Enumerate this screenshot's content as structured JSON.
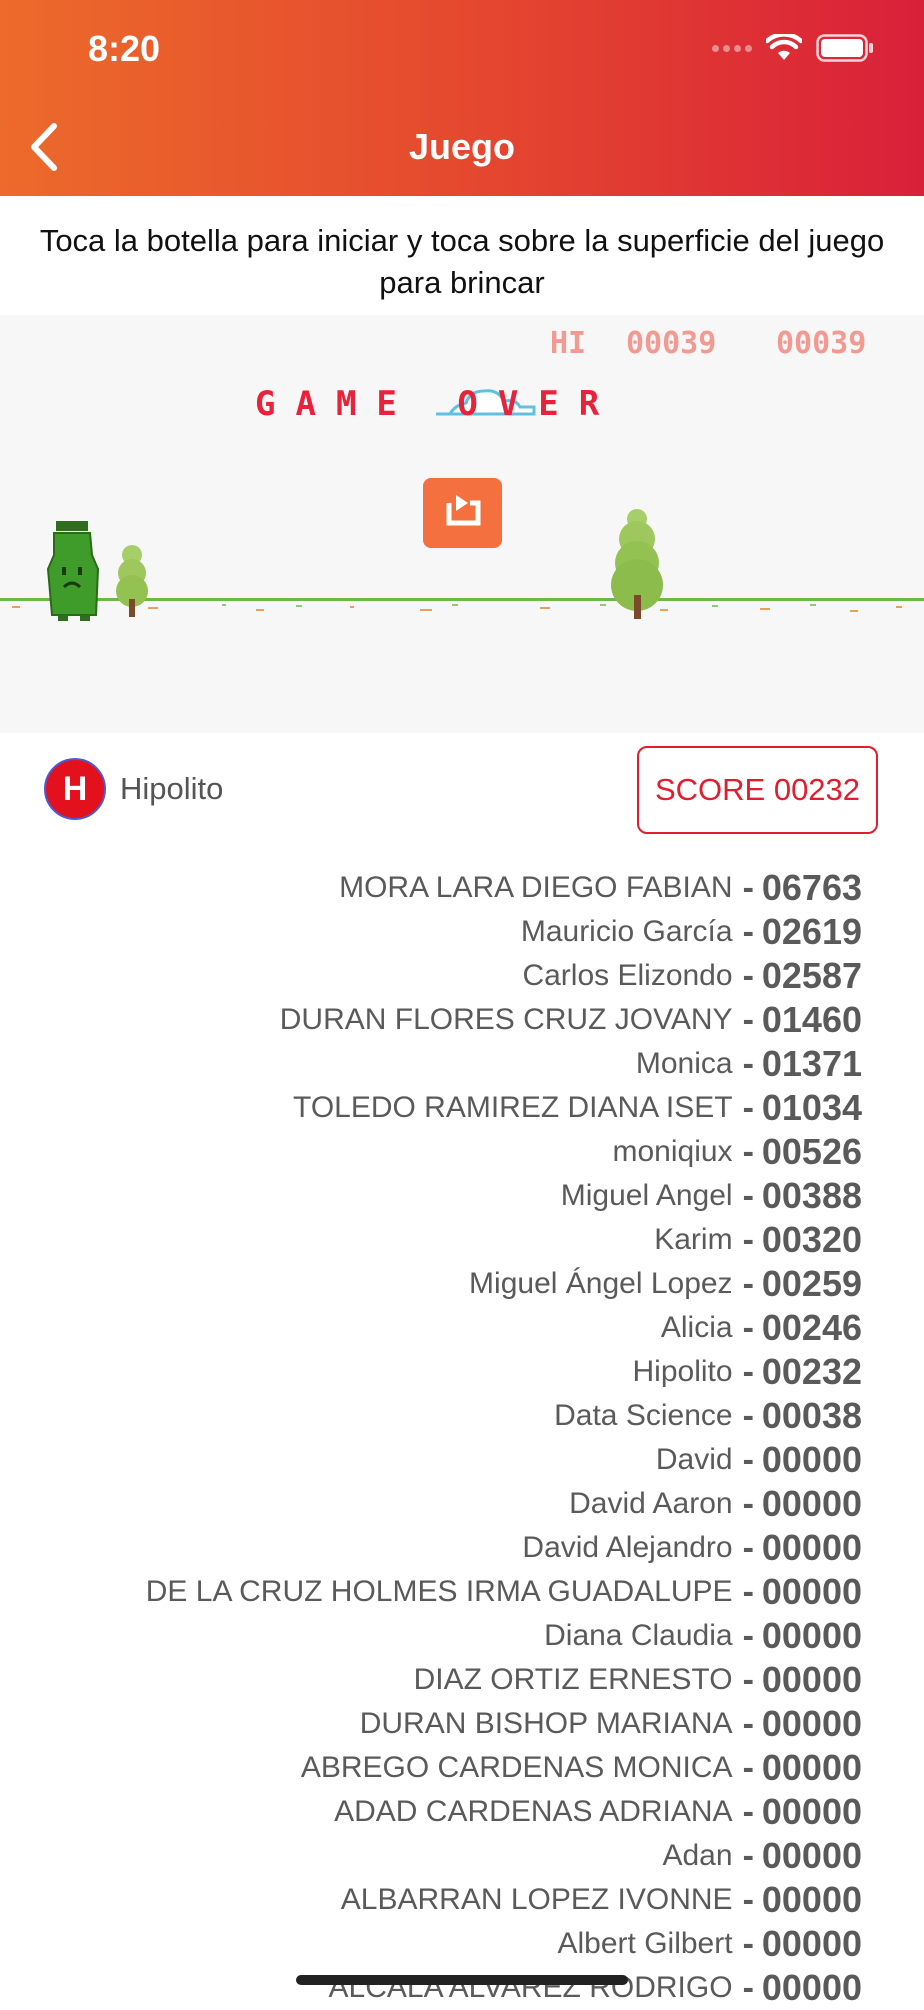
{
  "status_bar": {
    "time": "8:20"
  },
  "header": {
    "title": "Juego",
    "back_icon": "chevron-left-icon"
  },
  "instructions": "Toca la botella para iniciar y toca sobre la superficie del juego para brincar",
  "game": {
    "hi_label": "HI",
    "hi_score": "00039",
    "current_score": "00039",
    "game_over_text": "GAME OVER",
    "restart_icon": "restart-icon"
  },
  "user": {
    "initial": "H",
    "name": "Hipolito"
  },
  "score_label": "SCORE 00232",
  "leaderboard": [
    {
      "name": "MORA LARA DIEGO FABIAN",
      "score": "06763"
    },
    {
      "name": "Mauricio García",
      "score": "02619"
    },
    {
      "name": "Carlos Elizondo",
      "score": "02587"
    },
    {
      "name": "DURAN FLORES CRUZ JOVANY",
      "score": "01460"
    },
    {
      "name": "Monica",
      "score": "01371"
    },
    {
      "name": "TOLEDO RAMIREZ DIANA ISET",
      "score": "01034"
    },
    {
      "name": "moniqiux",
      "score": "00526"
    },
    {
      "name": "Miguel Angel",
      "score": "00388"
    },
    {
      "name": "Karim",
      "score": "00320"
    },
    {
      "name": "Miguel Ángel Lopez",
      "score": "00259"
    },
    {
      "name": "Alicia",
      "score": "00246"
    },
    {
      "name": "Hipolito",
      "score": "00232"
    },
    {
      "name": "Data Science",
      "score": "00038"
    },
    {
      "name": "David",
      "score": "00000"
    },
    {
      "name": "David Aaron",
      "score": "00000"
    },
    {
      "name": "David Alejandro",
      "score": "00000"
    },
    {
      "name": "DE LA CRUZ HOLMES IRMA GUADALUPE",
      "score": "00000"
    },
    {
      "name": "Diana Claudia",
      "score": "00000"
    },
    {
      "name": "DIAZ ORTIZ ERNESTO",
      "score": "00000"
    },
    {
      "name": "DURAN BISHOP MARIANA",
      "score": "00000"
    },
    {
      "name": "ABREGO CARDENAS MONICA",
      "score": "00000"
    },
    {
      "name": "ADAD CARDENAS ADRIANA",
      "score": "00000"
    },
    {
      "name": "Adan",
      "score": "00000"
    },
    {
      "name": "ALBARRAN LOPEZ IVONNE",
      "score": "00000"
    },
    {
      "name": "Albert Gilbert",
      "score": "00000"
    },
    {
      "name": "ALCALA ALVAREZ RODRIGO",
      "score": "00000"
    }
  ],
  "leaderboard_separator": "-",
  "colors": {
    "accent": "#e21d2d",
    "header_start": "#ec6a2b",
    "header_end": "#d9203a",
    "game_text": "#e8223a",
    "restart_button": "#f4703e"
  }
}
